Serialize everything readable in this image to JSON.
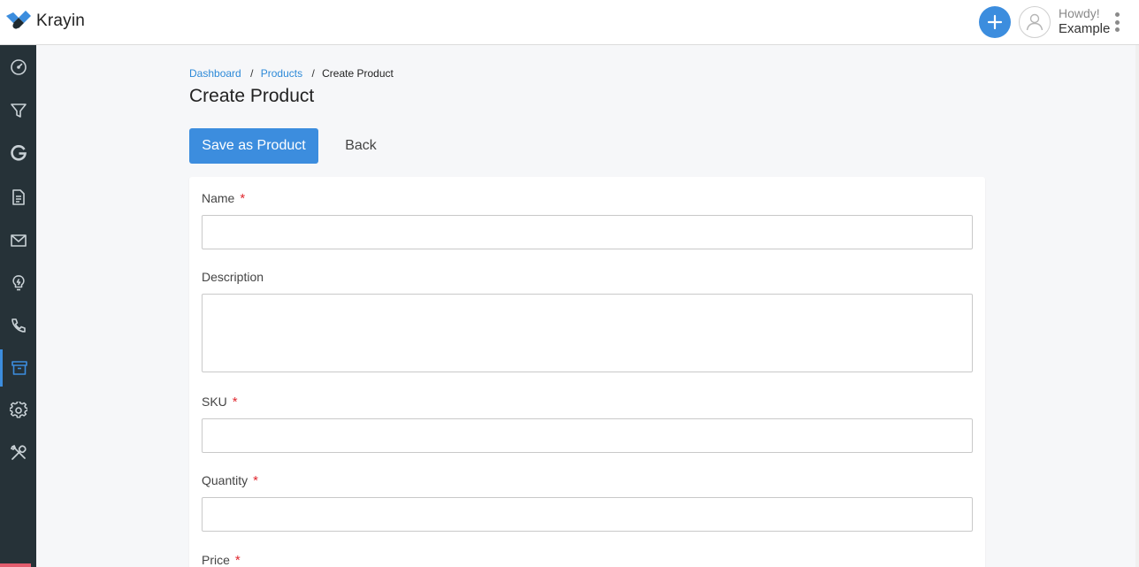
{
  "app": {
    "brand": "Krayin",
    "colors": {
      "accent": "#3c8dde",
      "sidebar": "#263238",
      "link": "#2e8ad8",
      "required": "#e0282f"
    }
  },
  "header": {
    "greeting": "Howdy!",
    "user_name": "Example",
    "icons": [
      "krayin-logo-icon",
      "plus-icon",
      "user-avatar-icon",
      "kebab-menu-icon"
    ]
  },
  "sidebar": {
    "items": [
      {
        "icon": "dashboard-gauge-icon",
        "active": false
      },
      {
        "icon": "filter-leads-icon",
        "active": false
      },
      {
        "icon": "google-icon",
        "active": false
      },
      {
        "icon": "document-quotes-icon",
        "active": false
      },
      {
        "icon": "mail-icon",
        "active": false
      },
      {
        "icon": "lightbulb-activities-icon",
        "active": false
      },
      {
        "icon": "phone-contacts-icon",
        "active": false
      },
      {
        "icon": "archive-products-icon",
        "active": true
      },
      {
        "icon": "settings-gear-icon",
        "active": false
      },
      {
        "icon": "tools-configuration-icon",
        "active": false
      }
    ]
  },
  "breadcrumb": {
    "items": [
      {
        "label": "Dashboard"
      },
      {
        "label": "Products"
      },
      {
        "label": "Create Product"
      }
    ]
  },
  "page": {
    "title": "Create Product",
    "save_label": "Save as Product",
    "back_label": "Back"
  },
  "form": {
    "fields": [
      {
        "label": "Name",
        "required_mark": "*",
        "value": ""
      },
      {
        "label": "Description",
        "value": ""
      },
      {
        "label": "SKU",
        "required_mark": "*",
        "value": ""
      },
      {
        "label": "Quantity",
        "required_mark": "*",
        "value": ""
      },
      {
        "label": "Price",
        "required_mark": "*"
      }
    ]
  }
}
